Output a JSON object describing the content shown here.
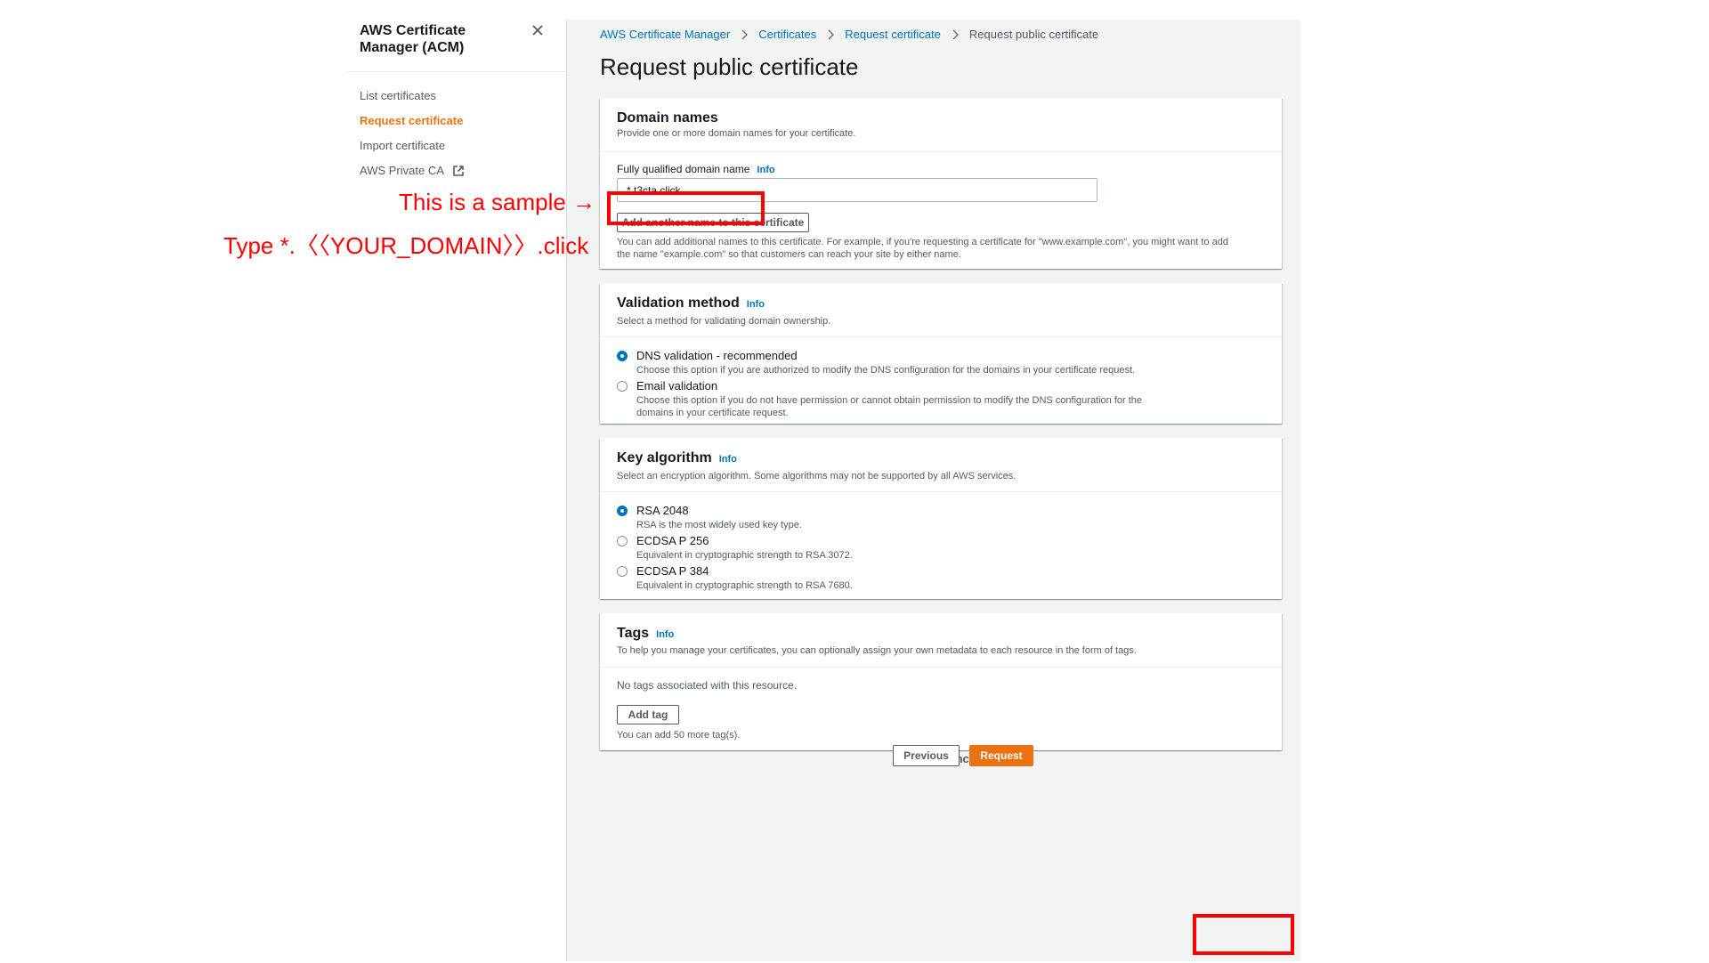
{
  "sidebar": {
    "title": "AWS Certificate Manager (ACM)",
    "items": [
      {
        "label": "List certificates",
        "active": false
      },
      {
        "label": "Request certificate",
        "active": true
      },
      {
        "label": "Import certificate",
        "active": false
      },
      {
        "label": "AWS Private CA",
        "active": false,
        "external": true
      }
    ]
  },
  "breadcrumb": [
    "AWS Certificate Manager",
    "Certificates",
    "Request certificate",
    "Request public certificate"
  ],
  "page_title": "Request public certificate",
  "domain_names": {
    "title": "Domain names",
    "description": "Provide one or more domain names for your certificate.",
    "field_label": "Fully qualified domain name",
    "info": "Info",
    "value": "*.t3cta.click",
    "add_button": "Add another name to this certificate",
    "help_line1": "You can add additional names to this certificate. For example, if you're requesting a certificate for \"www.example.com\", you might want to add",
    "help_line2": "the name \"example.com\" so that customers can reach your site by either name."
  },
  "validation": {
    "title": "Validation method",
    "info": "Info",
    "description": "Select a method for validating domain ownership.",
    "options": [
      {
        "label": "DNS validation - recommended",
        "desc": "Choose this option if you are authorized to modify the DNS configuration for the domains in your certificate request.",
        "selected": true
      },
      {
        "label": "Email validation",
        "desc": "Choose this option if you do not have permission or cannot obtain permission to modify the DNS configuration for the domains in your certificate request.",
        "selected": false
      }
    ]
  },
  "key_algorithm": {
    "title": "Key algorithm",
    "info": "Info",
    "description": "Select an encryption algorithm. Some algorithms may not be supported by all AWS services.",
    "options": [
      {
        "label": "RSA 2048",
        "desc": "RSA is the most widely used key type.",
        "selected": true
      },
      {
        "label": "ECDSA P 256",
        "desc": "Equivalent in cryptographic strength to RSA 3072.",
        "selected": false
      },
      {
        "label": "ECDSA P 384",
        "desc": "Equivalent in cryptographic strength to RSA 7680.",
        "selected": false
      }
    ]
  },
  "tags": {
    "title": "Tags",
    "info": "Info",
    "description": "To help you manage your certificates, you can optionally assign your own metadata to each resource in the form of tags.",
    "empty": "No tags associated with this resource.",
    "add_button": "Add tag",
    "help": "You can add 50 more tag(s)."
  },
  "actions": {
    "cancel": "Cancel",
    "previous": "Previous",
    "request": "Request"
  },
  "annotations": {
    "sample_note": "This is a sample →",
    "type_note": "Type  *.〈〈YOUR_DOMAIN〉〉.click"
  },
  "colors": {
    "accent": "#ec7211",
    "link": "#0073bb",
    "annotation": "#ff0000"
  }
}
